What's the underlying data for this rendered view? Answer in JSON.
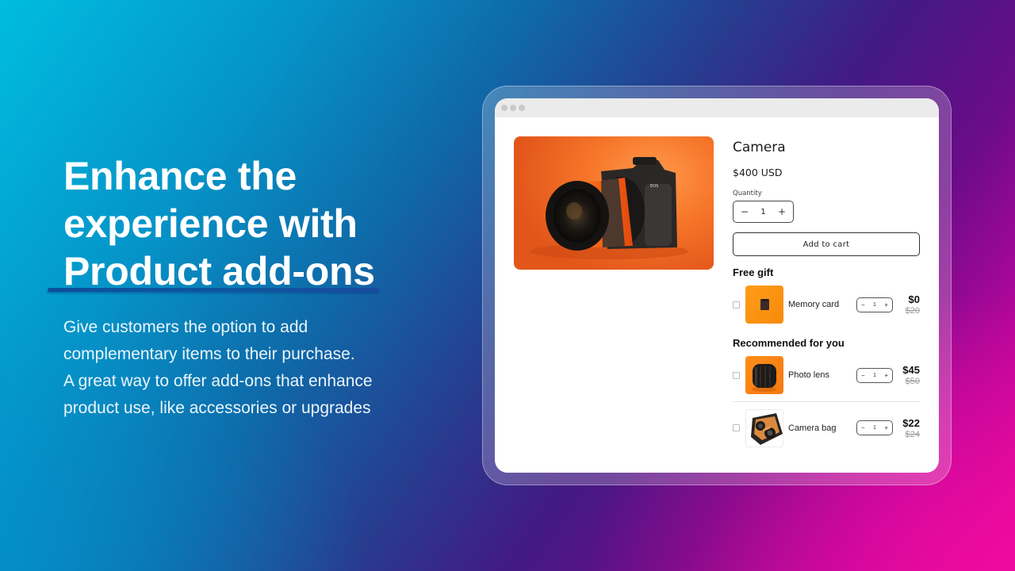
{
  "hero": {
    "title_lines": [
      "Enhance the",
      "experience with",
      "Product add-ons"
    ],
    "description_lines": [
      "Give customers the option to add",
      "complementary items to their purchase.",
      "A great way to offer add-ons that enhance",
      "product use, like accessories or upgrades"
    ]
  },
  "colors": {
    "gradient_start": "#00bcdf",
    "gradient_mid": "#421a83",
    "gradient_end": "#ec0a98",
    "underline": "#0c4f99"
  },
  "product": {
    "image_icon": "camera-photo",
    "title": "Camera",
    "price": "$400 USD",
    "quantity_label": "Quantity",
    "quantity": "1",
    "decrease_symbol": "−",
    "increase_symbol": "+",
    "add_to_cart_label": "Add to cart"
  },
  "free_gift": {
    "heading": "Free gift",
    "items": [
      {
        "name": "Memory card",
        "qty": "1",
        "price": "$0",
        "compare_price": "$20",
        "thumb_icon": "memory-card"
      }
    ]
  },
  "recommended": {
    "heading": "Recommended for you",
    "items": [
      {
        "name": "Photo lens",
        "qty": "1",
        "price": "$45",
        "compare_price": "$50",
        "thumb_icon": "lens"
      },
      {
        "name": "Camera bag",
        "qty": "1",
        "price": "$22",
        "compare_price": "$24",
        "thumb_icon": "camera-bag"
      }
    ]
  }
}
